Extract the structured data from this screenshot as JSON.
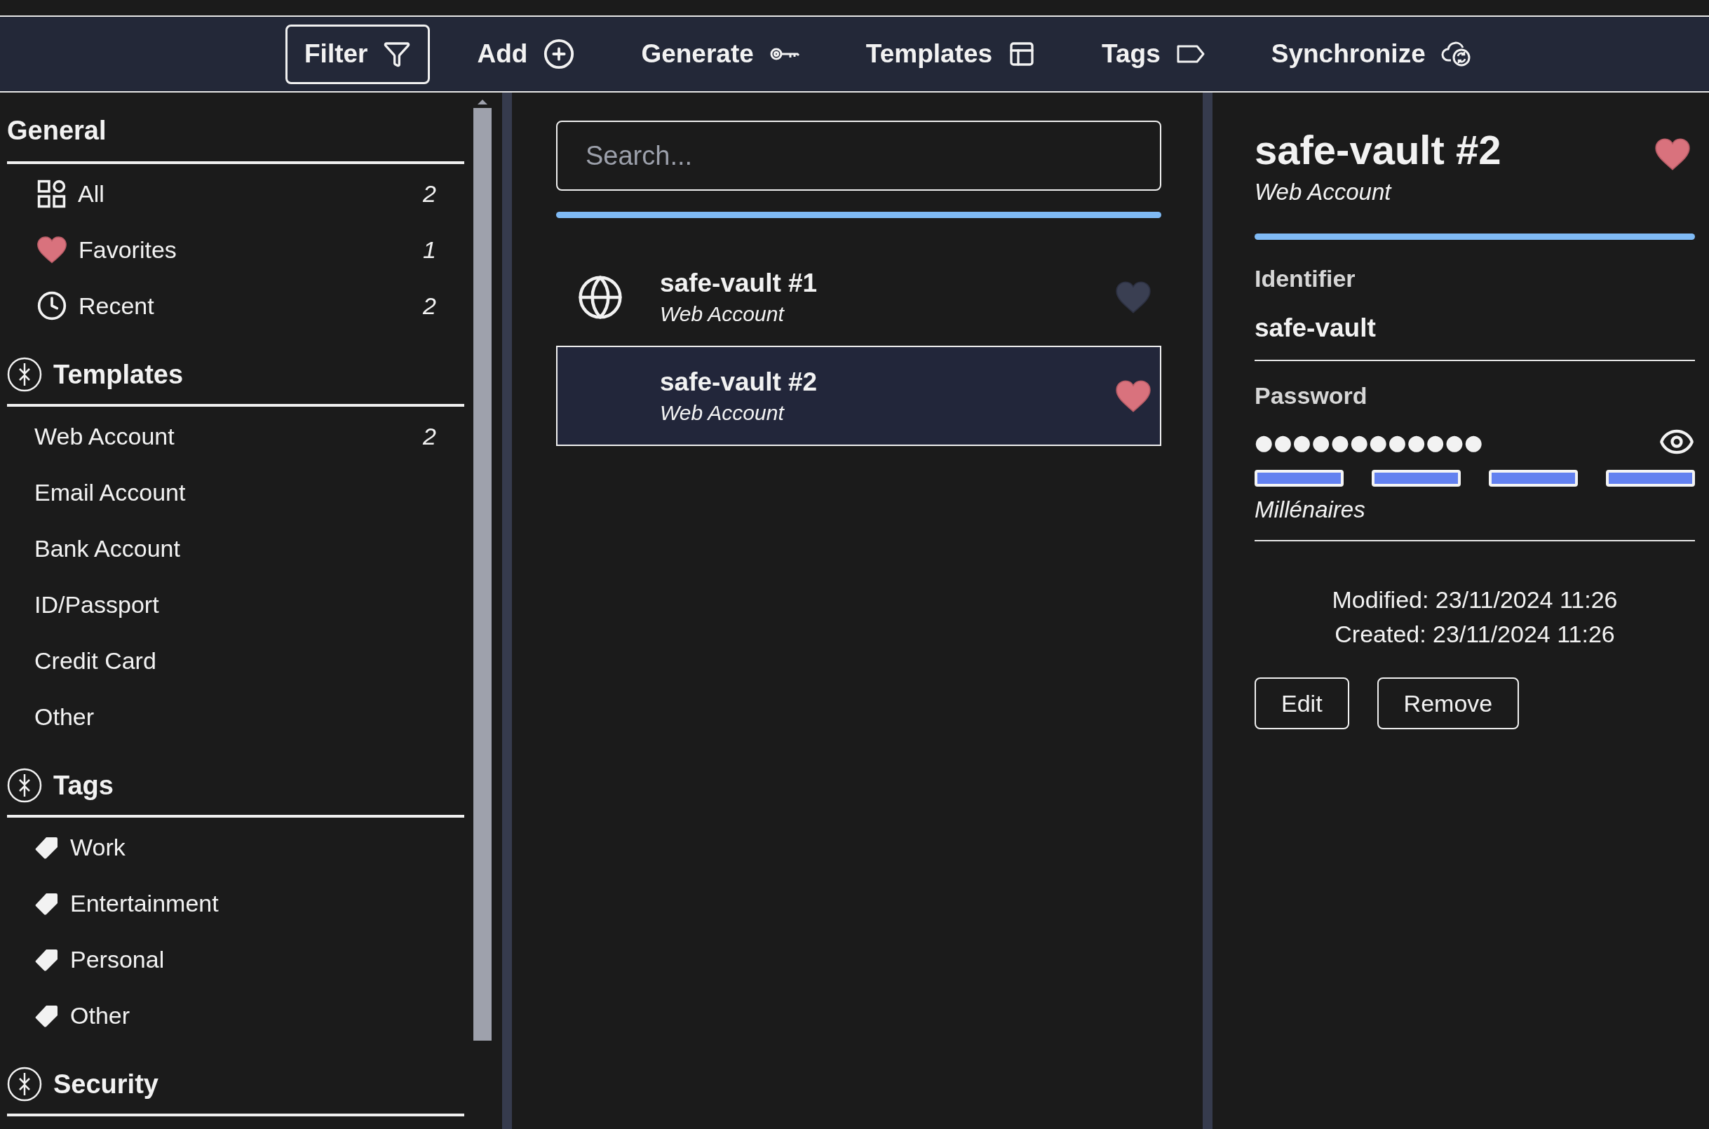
{
  "toolbar": [
    {
      "label": "Filter",
      "kind": "filter",
      "selected": true
    },
    {
      "label": "Add",
      "kind": "add",
      "selected": false
    },
    {
      "label": "Generate",
      "kind": "generate",
      "selected": false
    },
    {
      "label": "Templates",
      "kind": "templates",
      "selected": false
    },
    {
      "label": "Tags",
      "kind": "tags",
      "selected": false
    },
    {
      "label": "Synchronize",
      "kind": "sync",
      "selected": false
    }
  ],
  "sidebar": {
    "sections": [
      {
        "title": "General",
        "kind": "plain",
        "items": [
          {
            "label": "All",
            "kind": "all",
            "count": "2"
          },
          {
            "label": "Favorites",
            "kind": "favorites",
            "count": "1"
          },
          {
            "label": "Recent",
            "kind": "recent",
            "count": "2"
          }
        ]
      },
      {
        "title": "Templates",
        "kind": "group",
        "items": [
          {
            "label": "Web Account",
            "kind": "template",
            "count": "2"
          },
          {
            "label": "Email Account",
            "kind": "template"
          },
          {
            "label": "Bank Account",
            "kind": "template"
          },
          {
            "label": "ID/Passport",
            "kind": "template"
          },
          {
            "label": "Credit Card",
            "kind": "template"
          },
          {
            "label": "Other",
            "kind": "template"
          }
        ]
      },
      {
        "title": "Tags",
        "kind": "group",
        "items": [
          {
            "label": "Work",
            "kind": "tag"
          },
          {
            "label": "Entertainment",
            "kind": "tag"
          },
          {
            "label": "Personal",
            "kind": "tag"
          },
          {
            "label": "Other",
            "kind": "tag"
          }
        ]
      },
      {
        "title": "Security",
        "kind": "group"
      }
    ]
  },
  "list": {
    "search": {
      "placeholder": "Search..."
    },
    "entries": [
      {
        "title": "safe-vault #1",
        "subtitle": "Web Account",
        "kind": "globe",
        "favorite": false,
        "selected": false
      },
      {
        "title": "safe-vault #2",
        "subtitle": "Web Account",
        "kind": "plain",
        "favorite": true,
        "selected": true
      }
    ]
  },
  "detail": {
    "title": "safe-vault #2",
    "subtitle": "Web Account",
    "favorite": true,
    "fields": [
      {
        "label": "Identifier",
        "kind": "text",
        "value": "safe-vault"
      },
      {
        "label": "Password",
        "kind": "password",
        "value": "●●●●●●●●●●●●",
        "level": 1,
        "strength": "Millénaires"
      }
    ],
    "modified": "Modified: 23/11/2024 11:26",
    "created": "Created: 23/11/2024 11:26",
    "buttons": [
      "Edit",
      "Remove"
    ]
  }
}
